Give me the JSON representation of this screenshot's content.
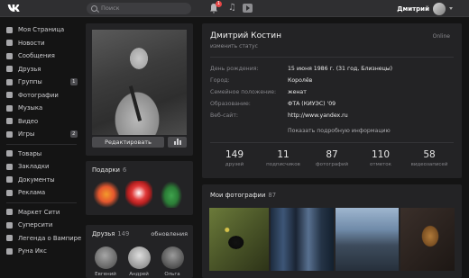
{
  "topbar": {
    "search_placeholder": "Поиск",
    "notifications_count": "1",
    "user_name": "Дмитрий"
  },
  "sidebar": {
    "items": [
      {
        "label": "Моя Страница",
        "icon": "home-icon"
      },
      {
        "label": "Новости",
        "icon": "news-icon"
      },
      {
        "label": "Сообщения",
        "icon": "messages-icon"
      },
      {
        "label": "Друзья",
        "icon": "friends-icon"
      },
      {
        "label": "Группы",
        "icon": "groups-icon",
        "badge": "1"
      },
      {
        "label": "Фотографии",
        "icon": "photos-icon"
      },
      {
        "label": "Музыка",
        "icon": "music-icon"
      },
      {
        "label": "Видео",
        "icon": "video-icon"
      },
      {
        "label": "Игры",
        "icon": "games-icon",
        "badge": "2"
      }
    ],
    "items2": [
      {
        "label": "Товары",
        "icon": "goods-icon"
      },
      {
        "label": "Закладки",
        "icon": "bookmarks-icon"
      },
      {
        "label": "Документы",
        "icon": "documents-icon"
      },
      {
        "label": "Реклама",
        "icon": "ads-icon"
      }
    ],
    "apps": [
      {
        "label": "Маркет Сити",
        "icon": "app-icon"
      },
      {
        "label": "Суперсити",
        "icon": "app-icon"
      },
      {
        "label": "Легенда о Вампире",
        "icon": "app-icon"
      },
      {
        "label": "Руна Икс",
        "icon": "app-icon"
      }
    ]
  },
  "avatar_panel": {
    "edit_label": "Редактировать"
  },
  "gifts": {
    "title": "Подарки",
    "count": "6"
  },
  "friends": {
    "title": "Друзья",
    "count": "149",
    "updates": "обновления",
    "names": [
      "Евгений",
      "Андрей",
      "Ольга"
    ]
  },
  "profile": {
    "name": "Дмитрий Костин",
    "status": "изменить статус",
    "online": "Online",
    "info": [
      {
        "label": "День рождения:",
        "value": "15 июня 1986 г. (31 год, Близнецы)"
      },
      {
        "label": "Город:",
        "value": "Королёв"
      },
      {
        "label": "Семейное положение:",
        "value": "женат"
      },
      {
        "label": "Образование:",
        "value": "ФТА (КИУЭС) '09"
      },
      {
        "label": "Веб-сайт:",
        "value": "http://www.yandex.ru"
      }
    ],
    "more_label": "Показать подробную информацию",
    "counters": [
      {
        "num": "149",
        "label": "друзей"
      },
      {
        "num": "11",
        "label": "подписчиков"
      },
      {
        "num": "87",
        "label": "фотографий"
      },
      {
        "num": "110",
        "label": "отметок"
      },
      {
        "num": "58",
        "label": "видеозаписей"
      }
    ]
  },
  "photos": {
    "title": "Мои фотографии",
    "count": "87"
  },
  "colors": {
    "background": "#141414",
    "panel": "#232325",
    "topbar": "#2f2f31",
    "badge_red": "#e64646"
  }
}
